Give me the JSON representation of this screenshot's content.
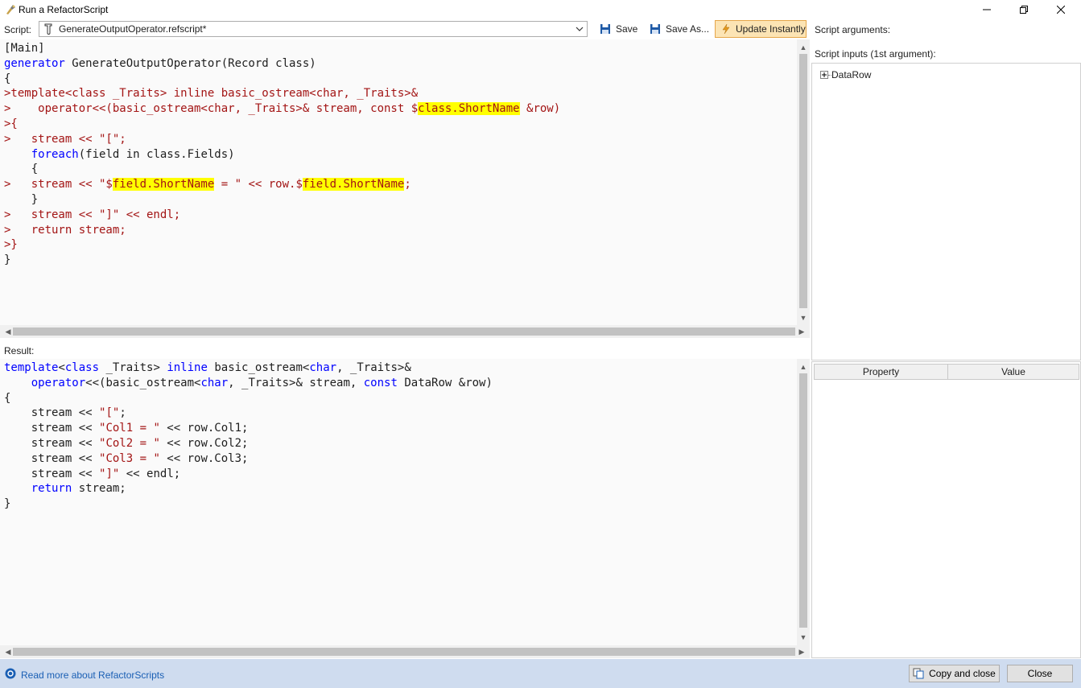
{
  "window": {
    "title": "Run a RefactorScript"
  },
  "toolbar": {
    "script_label": "Script:",
    "script_file": "GenerateOutputOperator.refscript*",
    "save_label": "Save",
    "save_as_label": "Save As...",
    "update_label": "Update Instantly"
  },
  "right_panel": {
    "script_args_label": "Script arguments:",
    "script_inputs_label": "Script inputs (1st argument):",
    "tree_root": "DataRow",
    "columns": {
      "property": "Property",
      "value": "Value"
    }
  },
  "result": {
    "label": "Result:"
  },
  "status": {
    "help_link": "Read more about RefactorScripts",
    "copy_close_label": "Copy and close",
    "close_label": "Close"
  },
  "colors": {
    "accent": "#fce4b4",
    "status_bar": "#cfdcef",
    "keyword": "#0000ff",
    "highlight": "#ffff00"
  }
}
